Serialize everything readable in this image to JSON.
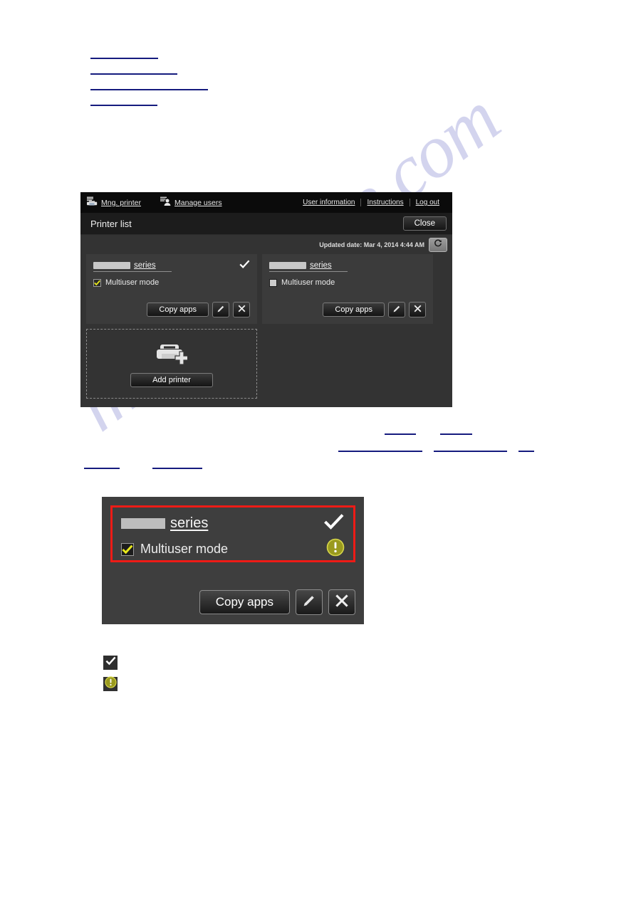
{
  "watermark": {
    "text": "manualshive.com"
  },
  "top_links": {
    "note": "Navigation hyperlinks rendered with underline rules only",
    "widths": [
      95,
      122,
      165,
      94
    ]
  },
  "mid_links": {
    "row1_widths": [
      44,
      45
    ],
    "row2_widths": [
      118,
      103,
      22
    ],
    "row3_widths": [
      40,
      68
    ]
  },
  "app": {
    "header": {
      "tabs": [
        {
          "label": "Mng. printer",
          "icon": "printer-icon"
        },
        {
          "label": "Manage users",
          "icon": "manage-users-icon"
        }
      ],
      "links": [
        "User information",
        "Instructions",
        "Log out"
      ]
    },
    "subbar": {
      "title": "Printer list",
      "close_label": "Close"
    },
    "updated": {
      "text": "Updated date: Mar 4, 2014 4:44 AM",
      "refresh_icon": "refresh-icon"
    },
    "printers": [
      {
        "name_redacted": true,
        "series_label": "series",
        "registered": true,
        "multiuser_label": "Multiuser mode",
        "multiuser_checked": true,
        "copy_apps_label": "Copy apps",
        "edit_icon": "pencil-icon",
        "delete_icon": "close-x-icon"
      },
      {
        "name_redacted": true,
        "series_label": "series",
        "registered": false,
        "multiuser_label": "Multiuser mode",
        "multiuser_checked": false,
        "copy_apps_label": "Copy apps",
        "edit_icon": "pencil-icon",
        "delete_icon": "close-x-icon"
      }
    ],
    "add_printer": {
      "label": "Add printer",
      "icon": "add-printer-icon"
    }
  },
  "detail": {
    "series_label": "series",
    "multiuser_label": "Multiuser mode",
    "copy_apps_label": "Copy apps",
    "registered_icon": "check-icon",
    "warning_icon": "warning-icon",
    "edit_icon": "pencil-icon",
    "delete_icon": "close-x-icon",
    "highlight_color": "#EE1B16"
  },
  "legend": [
    {
      "icon": "check-icon"
    },
    {
      "icon": "warning-icon"
    }
  ],
  "colors": {
    "panel_bg": "#333333",
    "header_bg": "#0B0B0B",
    "card_bg": "#3B3B3B",
    "accent_yellow": "#E8E81C",
    "warning_olive": "#9A9A1E",
    "link_blue": "#151B7E",
    "highlight_red": "#EE1B16"
  }
}
